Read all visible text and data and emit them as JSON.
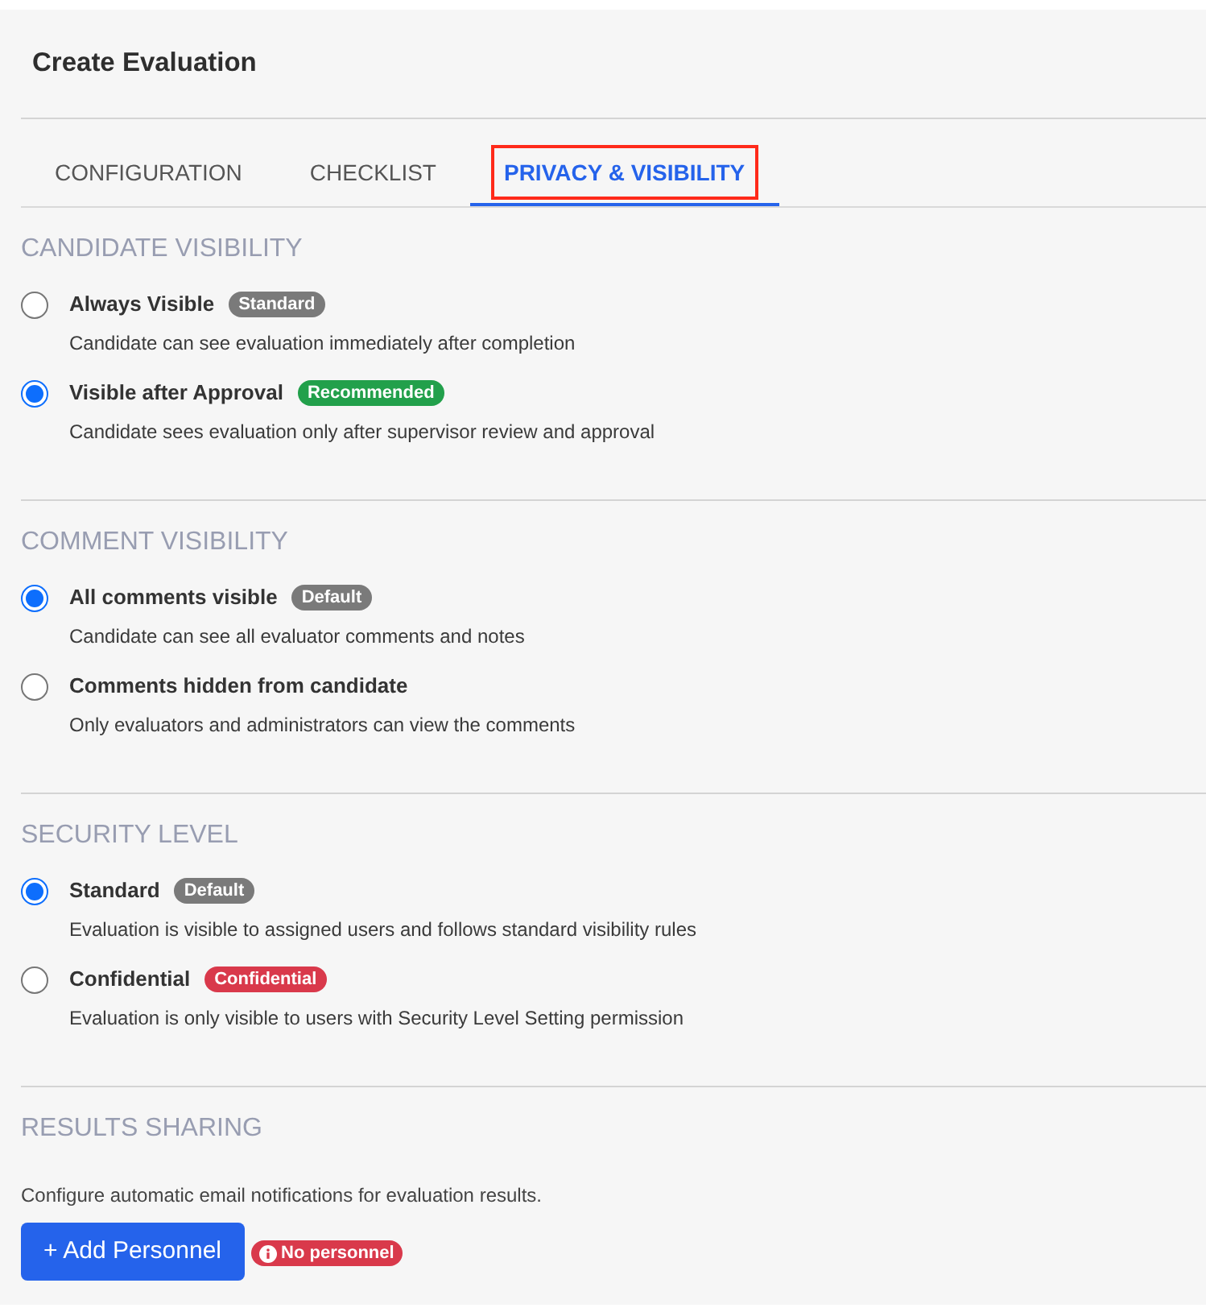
{
  "window": {
    "title": "Create Evaluation"
  },
  "tabs": [
    {
      "label": "CONFIGURATION",
      "selected": false,
      "highlighted": false
    },
    {
      "label": "CHECKLIST",
      "selected": false,
      "highlighted": false
    },
    {
      "label": "PRIVACY & VISIBILITY",
      "selected": true,
      "highlighted": true
    }
  ],
  "sections": [
    {
      "heading": "CANDIDATE VISIBILITY",
      "options": [
        {
          "label": "Always Visible",
          "badge": {
            "text": "Standard",
            "color": "#7a7a7a"
          },
          "description": "Candidate can see evaluation immediately after completion",
          "selected": false
        },
        {
          "label": "Visible after Approval",
          "badge": {
            "text": "Recommended",
            "color": "#22a04b"
          },
          "description": "Candidate sees evaluation only after supervisor review and approval",
          "selected": true
        }
      ]
    },
    {
      "heading": "COMMENT VISIBILITY",
      "options": [
        {
          "label": "All comments visible",
          "badge": {
            "text": "Default",
            "color": "#7a7a7a"
          },
          "description": "Candidate can see all evaluator comments and notes",
          "selected": true
        },
        {
          "label": "Comments hidden from candidate",
          "description": "Only evaluators and administrators can view the comments",
          "selected": false
        }
      ]
    },
    {
      "heading": "SECURITY LEVEL",
      "options": [
        {
          "label": "Standard",
          "badge": {
            "text": "Default",
            "color": "#7a7a7a"
          },
          "description": "Evaluation is visible to assigned users and follows standard visibility rules",
          "selected": true
        },
        {
          "label": "Confidential",
          "badge": {
            "text": "Confidential",
            "color": "#d9394b"
          },
          "description": "Evaluation is only visible to users with Security Level Setting permission",
          "selected": false
        }
      ]
    }
  ],
  "results_sharing": {
    "heading": "RESULTS SHARING",
    "description": "Configure automatic email notifications for evaluation results.",
    "button": "+ Add Personnel",
    "status_badge": {
      "text": "No personnel",
      "color": "#d9394b"
    }
  }
}
